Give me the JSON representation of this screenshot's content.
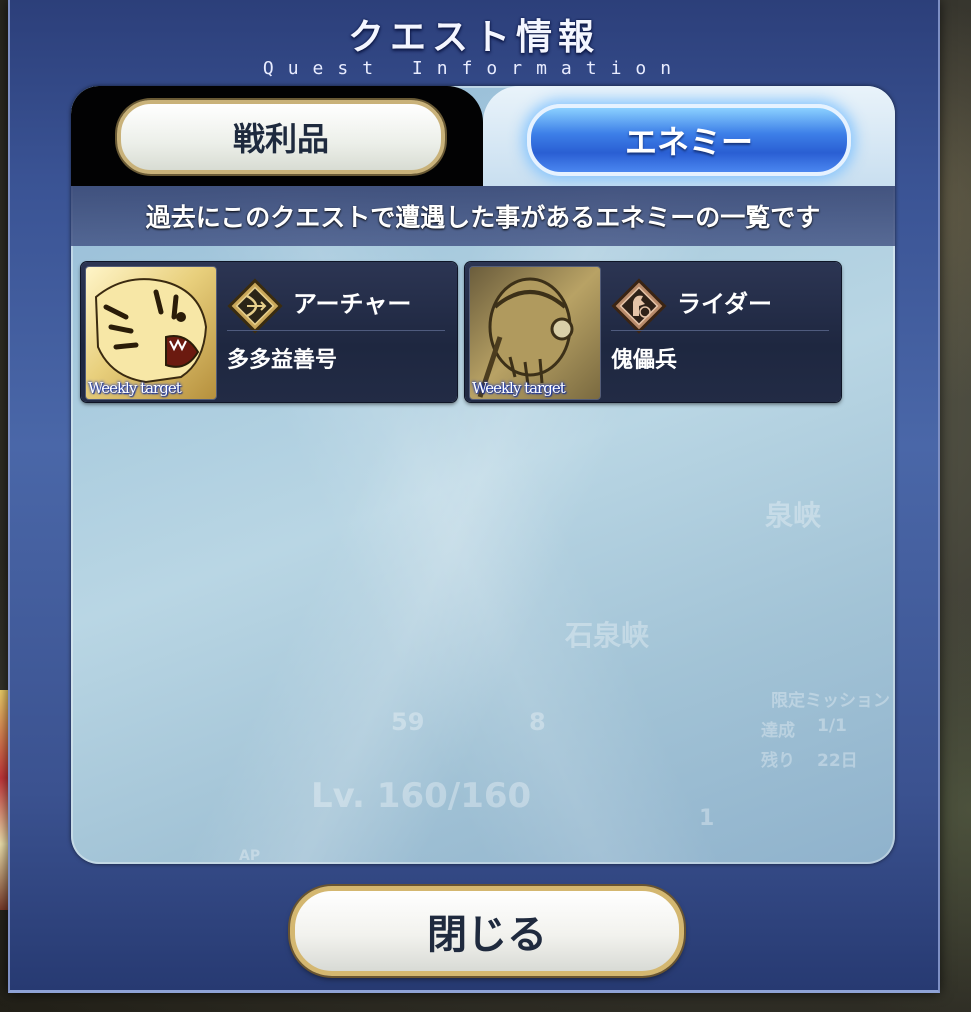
{
  "header": {
    "title": "クエスト情報",
    "subtitle": "Quest Information"
  },
  "tabs": [
    {
      "label": "戦利品",
      "active": false
    },
    {
      "label": "エネミー",
      "active": true
    }
  ],
  "notice": "過去にこのクエストで遭遇した事があるエネミーの一覧です",
  "enemies": [
    {
      "badge": "Weekly target",
      "class": "アーチャー",
      "class_icon": "archer-class-icon",
      "name": "多多益善号"
    },
    {
      "badge": "Weekly target",
      "class": "ライダー",
      "class_icon": "rider-class-icon",
      "name": "傀儡兵"
    }
  ],
  "background_ghost": {
    "location": "石泉峡",
    "location_partial": "泉峡",
    "level": "Lv. 160/160",
    "count_a": "59",
    "count_b": "8",
    "mission_title": "限定ミッション",
    "mission_done_label": "達成",
    "mission_done_value": "1/1",
    "mission_left_label": "残り",
    "mission_left_value": "22日",
    "badge_count": "1",
    "ap_label": "AP"
  },
  "close_label": "閉じる",
  "colors": {
    "window": "#3a5394",
    "active_tab": "#2a5fd3",
    "button_border": "#d4b770",
    "card": "#1e2740"
  }
}
